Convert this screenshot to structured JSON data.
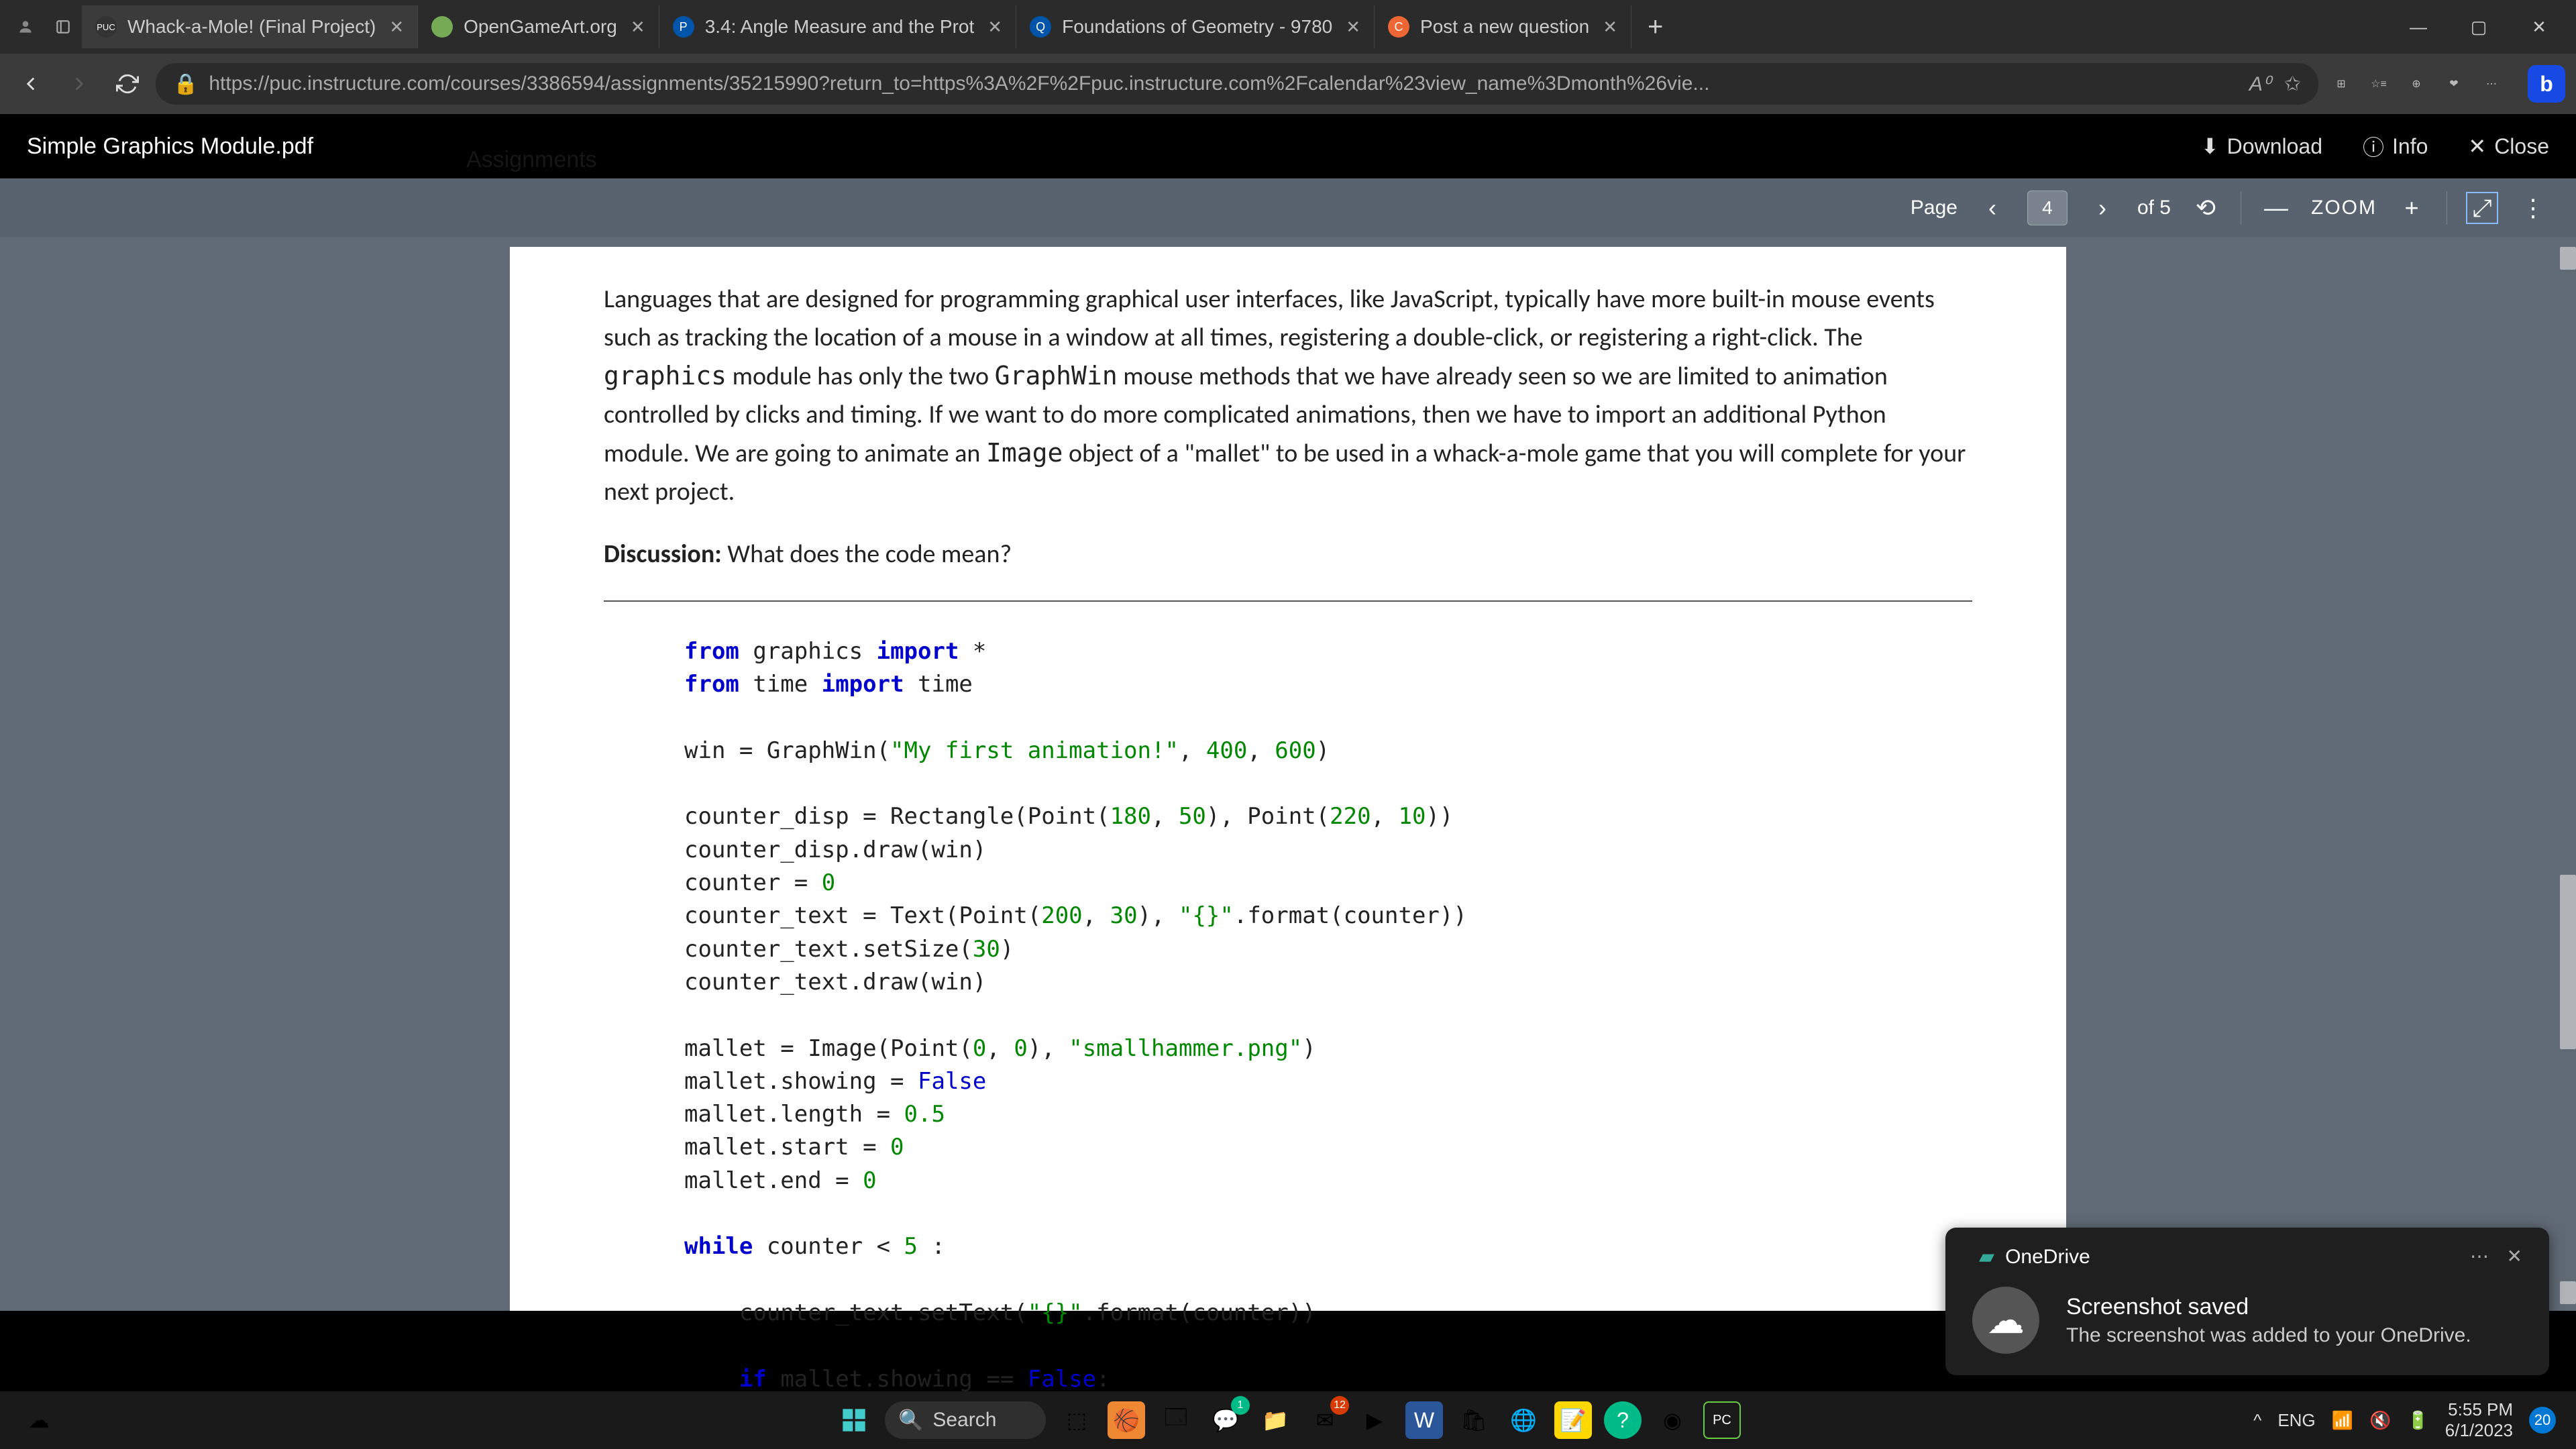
{
  "browser": {
    "tabs": [
      {
        "title": "Whack-a-Mole! (Final Project)",
        "favicon_bg": "#333",
        "favicon_text": "PUC"
      },
      {
        "title": "OpenGameArt.org",
        "favicon_bg": "#7a5",
        "favicon_text": ""
      },
      {
        "title": "3.4: Angle Measure and the Prot",
        "favicon_bg": "#05a",
        "favicon_text": "P"
      },
      {
        "title": "Foundations of Geometry - 9780",
        "favicon_bg": "#05a",
        "favicon_text": "Q"
      },
      {
        "title": "Post a new question",
        "favicon_bg": "#e63",
        "favicon_text": "C"
      }
    ],
    "url": "https://puc.instructure.com/courses/3386594/assignments/35215990?return_to=https%3A%2F%2Fpuc.instructure.com%2Fcalendar%23view_name%3Dmonth%26vie..."
  },
  "viewer": {
    "doc_title": "Simple Graphics Module.pdf",
    "download": "Download",
    "info": "Info",
    "close": "Close",
    "page_label": "Page",
    "page_current": "4",
    "page_total": "of 5",
    "zoom_label": "ZOOM"
  },
  "doc": {
    "paragraph": "Languages that are designed for programming graphical user interfaces, like JavaScript, typically have more built-in mouse events such as tracking the location of a mouse in a window at all times, registering a double-click, or registering a right-click. The  graphics  module has only the two  GraphWin  mouse methods that we have already seen so we are limited to animation controlled by clicks and timing. If we want to do more complicated animations, then we have to import an additional Python module. We are going to animate an  Image  object of a \"mallet\" to be used in a whack-a-mole game that you will complete for your next project.",
    "discussion_label": "Discussion:",
    "discussion_text": " What does the code mean?",
    "behind_text": "Assignments"
  },
  "search_placeholder": "Search",
  "notification": {
    "app": "OneDrive",
    "title": "Screenshot saved",
    "body": "The screenshot was added to your OneDrive."
  },
  "tray": {
    "lang": "ENG",
    "time": "5:55 PM",
    "date": "6/1/2023",
    "badge": "20"
  }
}
